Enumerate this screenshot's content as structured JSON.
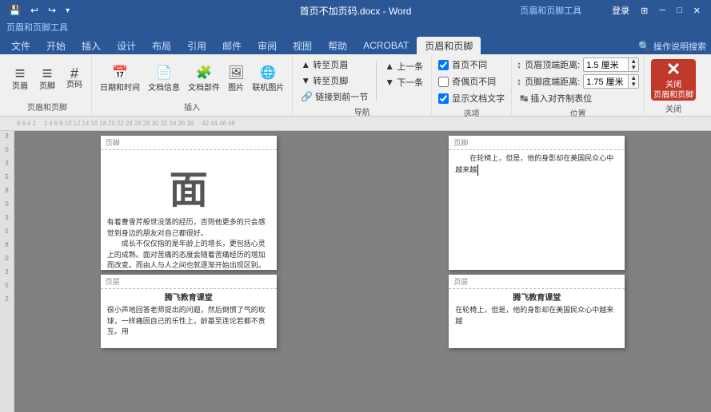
{
  "titleBar": {
    "title": "首页不加页码.docx - Word",
    "contextLabel": "页眉和页脚工具",
    "loginBtn": "登录",
    "undoIcon": "↩",
    "redoIcon": "↪",
    "saveIcon": "💾"
  },
  "ribbonTabs": {
    "contextHeader": "页眉和页脚工具",
    "tabs": [
      "文件",
      "开始",
      "插入",
      "设计",
      "布局",
      "引用",
      "邮件",
      "审阅",
      "视图",
      "帮助",
      "ACROBAT",
      "页眉和页脚"
    ],
    "activeTab": "页眉和页脚",
    "searchPlaceholder": "操作说明搜索",
    "searchIcon": "🔍"
  },
  "ribbonGroups": {
    "group1": {
      "label": "页眉和页脚",
      "btns": [
        {
          "label": "页眉",
          "icon": "≡"
        },
        {
          "label": "页脚",
          "icon": "≡"
        },
        {
          "label": "页码",
          "icon": "#"
        }
      ]
    },
    "group2": {
      "label": "插入",
      "btns": [
        {
          "label": "日期和时间",
          "icon": "📅"
        },
        {
          "label": "文档信息",
          "icon": "📄"
        },
        {
          "label": "文档部件",
          "icon": "🧩"
        },
        {
          "label": "图片",
          "icon": "🖼"
        },
        {
          "label": "联机图片",
          "icon": "🌐"
        }
      ]
    },
    "group3": {
      "label": "导航",
      "btns": [
        {
          "label": "转至页眉",
          "icon": "↑"
        },
        {
          "label": "转至页脚",
          "icon": "↓"
        },
        {
          "label": "链接到前一节",
          "icon": "🔗"
        }
      ],
      "stackBtns": [
        {
          "label": "上一条",
          "icon": "▲"
        },
        {
          "label": "下一条",
          "icon": "▼"
        }
      ]
    },
    "group4": {
      "label": "选项",
      "checkboxes": [
        {
          "label": "首页不同",
          "checked": true
        },
        {
          "label": "奇偶页不同",
          "checked": false
        },
        {
          "label": "显示文档文字",
          "checked": true
        }
      ]
    },
    "group5": {
      "label": "位置",
      "rows": [
        {
          "label": "页眉顶端距离:",
          "value": "1.5 厘米",
          "icon": "↕"
        },
        {
          "label": "页脚底端距离:",
          "value": "1.75 厘米",
          "icon": "↕"
        },
        {
          "label": "插入对齐制表位",
          "icon": "↹"
        }
      ]
    },
    "group6": {
      "label": "关闭",
      "closeLabel": "关闭\n页眉和页脚"
    }
  },
  "ruler": {
    "marks": [
      "8",
      "6",
      "4",
      "2",
      "",
      "2",
      "4",
      "6",
      "8",
      "10",
      "12",
      "14",
      "16",
      "18",
      "20",
      "22",
      "24",
      "26",
      "28",
      "30",
      "32",
      "34",
      "36",
      "38",
      "",
      "42",
      "44",
      "46",
      "48"
    ]
  },
  "pages": {
    "page1": {
      "headerLabel": "页脚",
      "bigChar": "面",
      "bodyText": "有着曹雪芹般世没落的经历，否则他更多的只会感觉到身边的朋友对自己都很好。\n　　成长不仅仅指的是年龄上的增长，更包括心灵上的成熟。面对苦痛的态度会随着苦痛经历的增加而改变。而由人与人之间也就逐渐开始出现区别。消极的人被苦难吞灭，积极的人迎着苦难战斗，最终获得在顺境中很难取得的成功。\n　　美国总统罗斯福小时候非常胆小。他的脸上经常显现出一种恐惧的表情。在上课的时候，他会因为被老师叫起来背诵而双脚不由自主地发抖，嘴唇也像暴露在严寒中一样不断颤抖。他说话非常含糊，因为他很懦弱，连大声地把话说清楚的勇气都很缺乏。他会",
      "footerLabel": "页脚",
      "footerContent": ""
    },
    "page1bottom": {
      "headerLabel": "页层",
      "footerContent": "腾飞教育课堂\n很小声地回答老师提出的问题，然后倒惯了气的玫球，一样痛固自己的乐性上，龄基至连论若都不责互。用"
    },
    "page2": {
      "headerLabel": "页脚",
      "bodyText": "在轮椅上，但是，他的身影却在美国民众心中越来越\n",
      "footerLabel": "页脚",
      "footerContent": ""
    },
    "page2bottom": {
      "headerLabel": "页层",
      "footerContent": "腾飞教育课堂\n在轮椅上，但是，他的身影却在美国民众心中越来越"
    }
  },
  "colors": {
    "titleBarBg": "#2b5797",
    "ribbonBg": "#f0f0f0",
    "activeTabBg": "#f0f0f0",
    "pageBg": "#ffffff",
    "docBg": "#808080",
    "closeBtn": "#c0392b",
    "accentBlue": "#2b5797"
  }
}
